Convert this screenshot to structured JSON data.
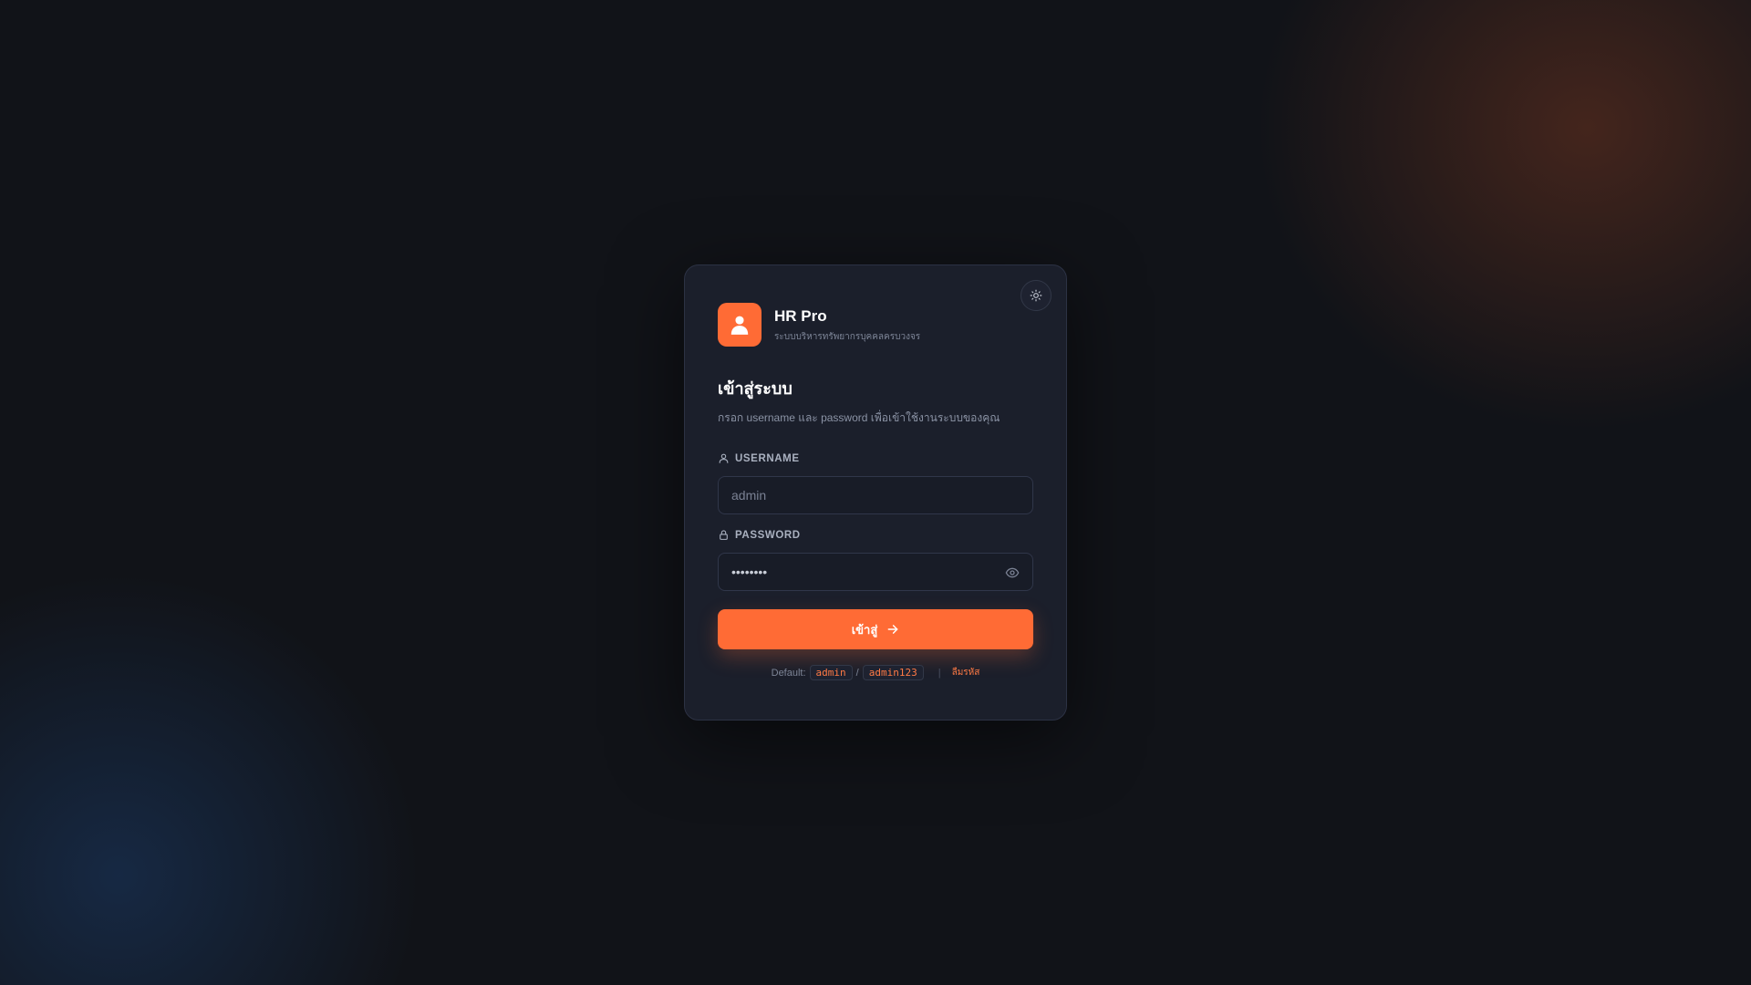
{
  "brand": {
    "name": "HR Pro",
    "tagline": "ระบบบริหารทรัพยากรบุคคลครบวงจร"
  },
  "login": {
    "heading": "เข้าสู่ระบบ",
    "subheading": "กรอก username และ password เพื่อเข้าใช้งานระบบของคุณ",
    "username_label": "USERNAME",
    "username_placeholder": "admin",
    "password_label": "PASSWORD",
    "password_value": "••••••••",
    "submit_label": "เข้าสู่"
  },
  "footer": {
    "default_label": "Default:",
    "default_user": "admin",
    "divider": "/",
    "default_pass": "admin123",
    "separator": "|",
    "help_link": "ลืมรหัส"
  },
  "icons": {
    "theme_toggle": "sun-icon",
    "logo": "user-icon",
    "username": "user-icon",
    "password": "lock-icon",
    "reveal": "eye-icon",
    "submit": "arrow-right-icon"
  },
  "colors": {
    "accent": "#ff6b35",
    "card": "#1b1f2b",
    "background": "#111318"
  }
}
